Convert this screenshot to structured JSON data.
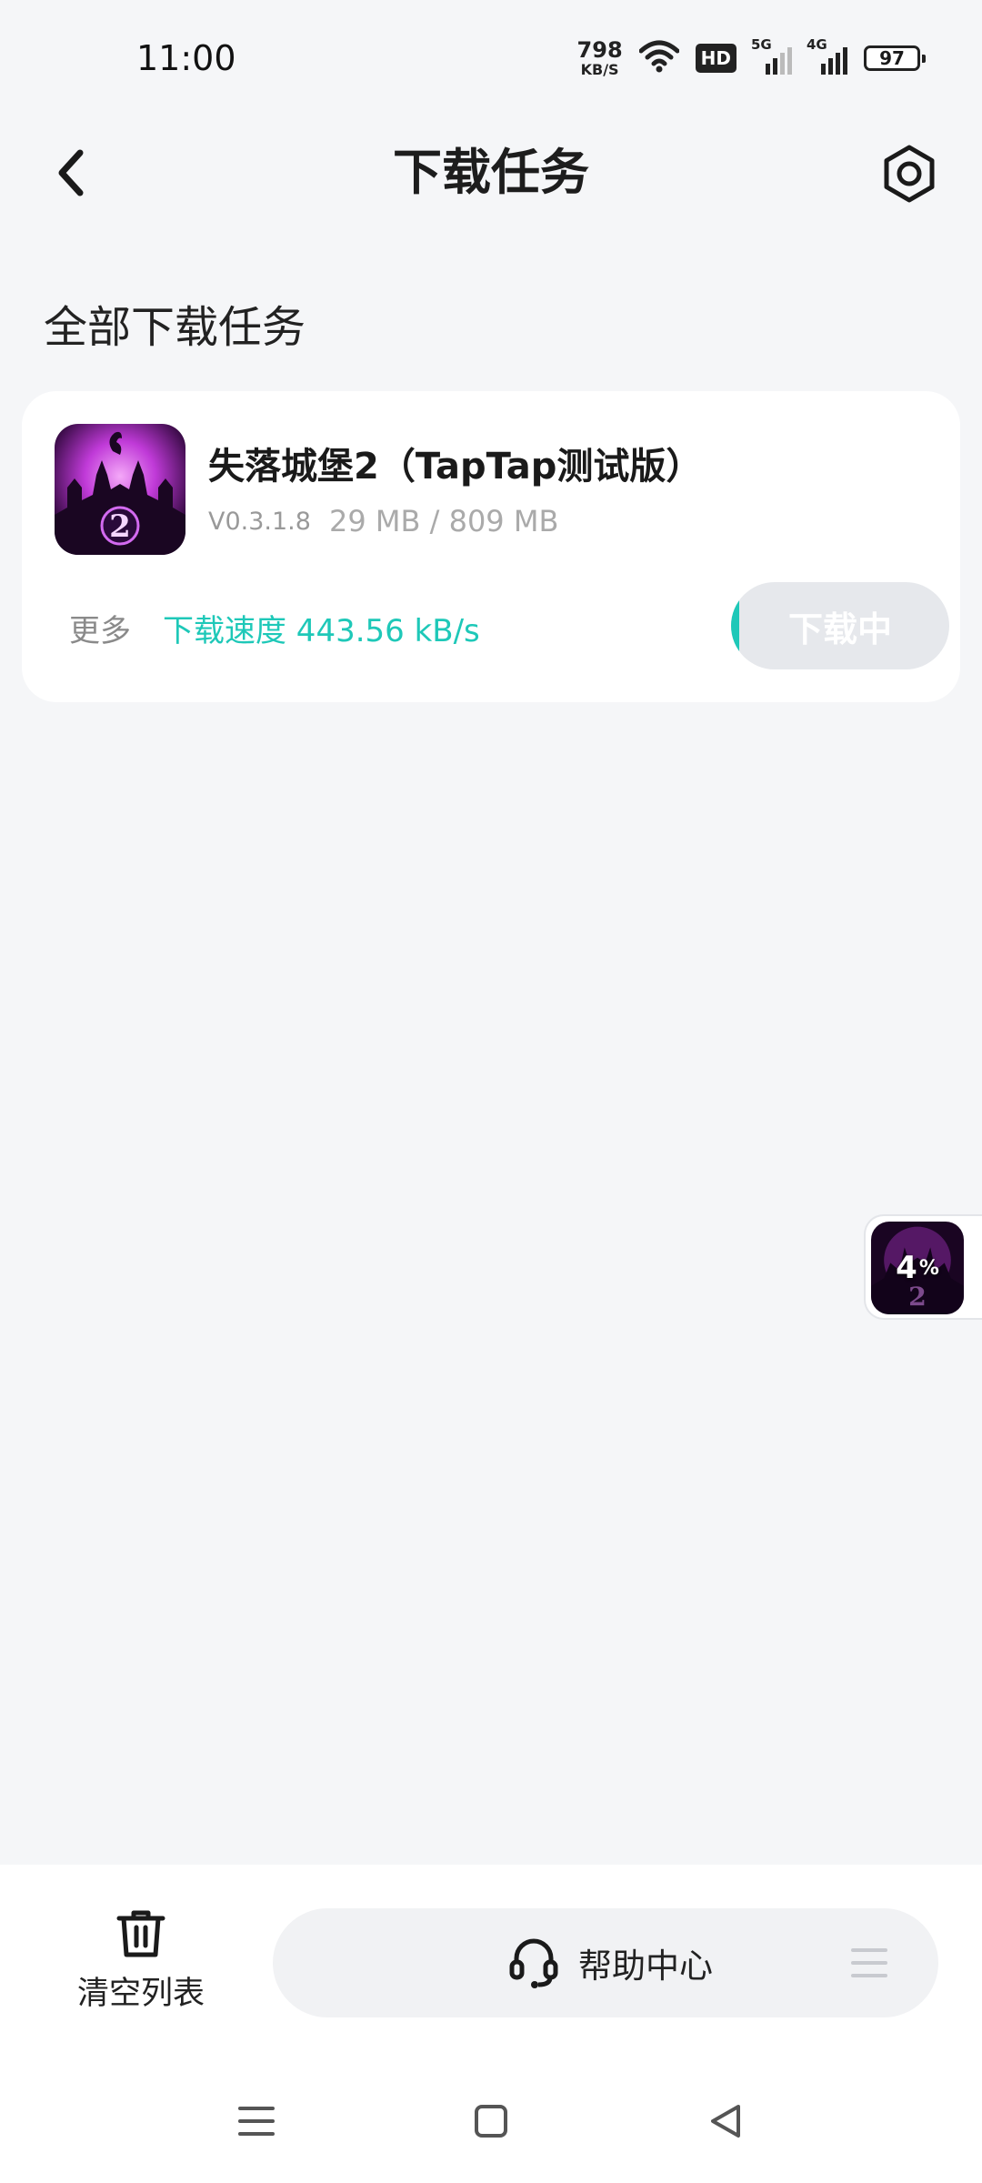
{
  "status_bar": {
    "time": "11:00",
    "net_speed_value": "798",
    "net_speed_unit": "KB/S",
    "hd_label": "HD",
    "sim1_label": "5G",
    "sim2_label": "4G",
    "battery": "97",
    "icons": [
      "wifi-icon",
      "signal-5g-icon",
      "signal-4g-icon",
      "battery-icon"
    ]
  },
  "header": {
    "title": "下载任务",
    "back_icon": "chevron-left-icon",
    "settings_icon": "settings-icon"
  },
  "section": {
    "title": "全部下载任务"
  },
  "task": {
    "name": "失落城堡2（TapTap测试版）",
    "version": "V0.3.1.8",
    "size": "29 MB / 809 MB",
    "more_label": "更多",
    "speed_label": "下载速度 443.56 kB/s",
    "button_label": "下载中",
    "progress": 0.036,
    "accent_color": "#1ec8b8"
  },
  "floating_widget": {
    "percent": "4",
    "percent_sign": "%"
  },
  "bottom": {
    "clear_label": "清空列表",
    "help_label": "帮助中心",
    "icons": [
      "trash-icon",
      "headset-icon",
      "menu-icon"
    ]
  },
  "nav": {
    "icons": [
      "recents-icon",
      "home-icon",
      "back-icon"
    ]
  }
}
